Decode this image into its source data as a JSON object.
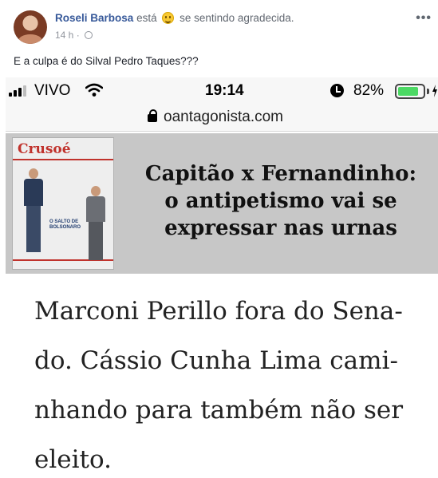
{
  "post": {
    "author": "Roseli Barbosa",
    "feeling_prefix": "está",
    "feeling_text": "se sentindo agradecida.",
    "timestamp": "14 h",
    "more_label": "•••",
    "text": "E a culpa é do Silval Pedro Taques???"
  },
  "screenshot": {
    "status": {
      "carrier": "VIVO",
      "time": "19:14",
      "battery_pct": "82%",
      "battery_level": 0.82
    },
    "url": "oantagonista.com",
    "banner": {
      "brand": "Crusoé",
      "cover_title": "O SALTO DE BOLSONARO",
      "headline_lines": [
        "Capitão x Fernandinho:",
        "o antipetismo vai se",
        "expressar nas urnas"
      ]
    },
    "article_lines": [
      "Marconi Perillo fora do Sena-",
      "do. Cássio Cunha Lima cami-",
      "nhando para também não ser",
      "eleito."
    ]
  },
  "colors": {
    "author_link": "#365899",
    "battery_fill": "#4cd964",
    "banner_bg": "#c7c7c7",
    "brand_red": "#c0322c"
  },
  "icons": [
    "profile-avatar",
    "smile-emoji-icon",
    "globe-icon",
    "signal-icon",
    "wifi-icon",
    "alarm-icon",
    "battery-icon",
    "lock-icon"
  ]
}
